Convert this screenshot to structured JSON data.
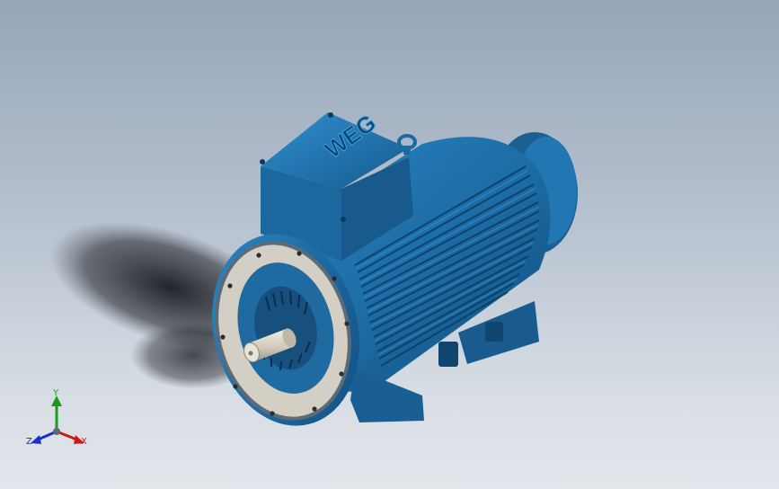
{
  "viewport": {
    "background_top": "#97a5b8",
    "background_bottom": "#e2e6eb",
    "model_color": "#1f6aa0",
    "shaft_color": "#d8d2c4"
  },
  "model": {
    "nameplate_logo": "WEG"
  },
  "triad": {
    "x_label": "X",
    "y_label": "Y",
    "z_label": "Z",
    "x_color": "#d01818",
    "y_color": "#1a9c1a",
    "z_color": "#1a2fd0"
  }
}
